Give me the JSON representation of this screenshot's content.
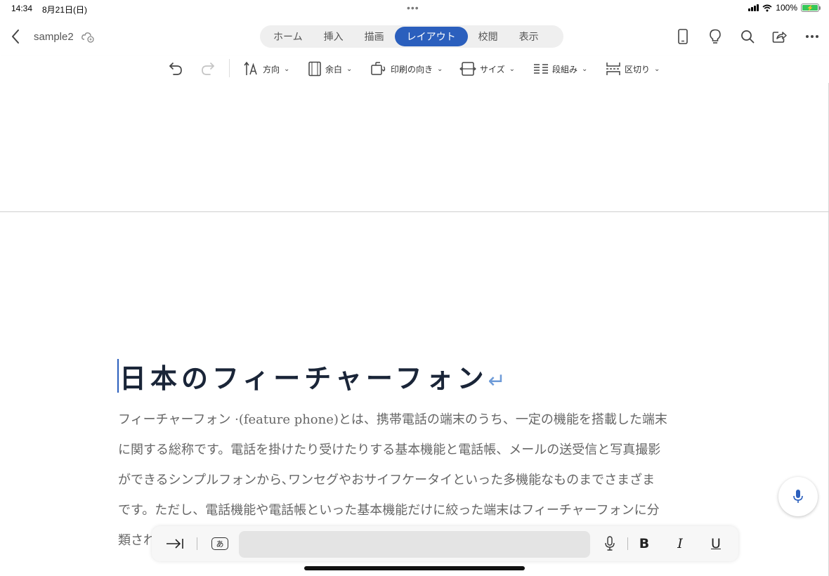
{
  "status_bar": {
    "time": "14:34",
    "date": "8月21日(日)",
    "battery": "100%"
  },
  "header": {
    "doc_name": "sample2",
    "tabs": [
      {
        "label": "ホーム",
        "active": false
      },
      {
        "label": "挿入",
        "active": false
      },
      {
        "label": "描画",
        "active": false
      },
      {
        "label": "レイアウト",
        "active": true
      },
      {
        "label": "校閲",
        "active": false
      },
      {
        "label": "表示",
        "active": false
      }
    ],
    "accent_color": "#2b5fbd"
  },
  "ribbon": {
    "direction": "方向",
    "margins": "余白",
    "orientation": "印刷の向き",
    "size": "サイズ",
    "columns": "段組み",
    "breaks": "区切り"
  },
  "document": {
    "heading": "日本のフィーチャーフォン",
    "body_lines": [
      "フィーチャーフォン ·(feature phone)とは、携帯電話の端末のうち、一定の機能を搭載した端末",
      "に関する総称です。電話を掛けたり受けたりする基本機能と電話帳、メールの送受信と写真撮影",
      "ができるシンプルフォンから､ワンセグやおサイフケータイといった多機能なものまでさまざま",
      "です。ただし、電話機能や電話帳といった基本機能だけに絞った端末はフィーチャーフォンに分",
      "類され"
    ]
  },
  "bottom_bar": {
    "bold": "B",
    "italic": "I",
    "underline": "U",
    "kana": "あ"
  }
}
